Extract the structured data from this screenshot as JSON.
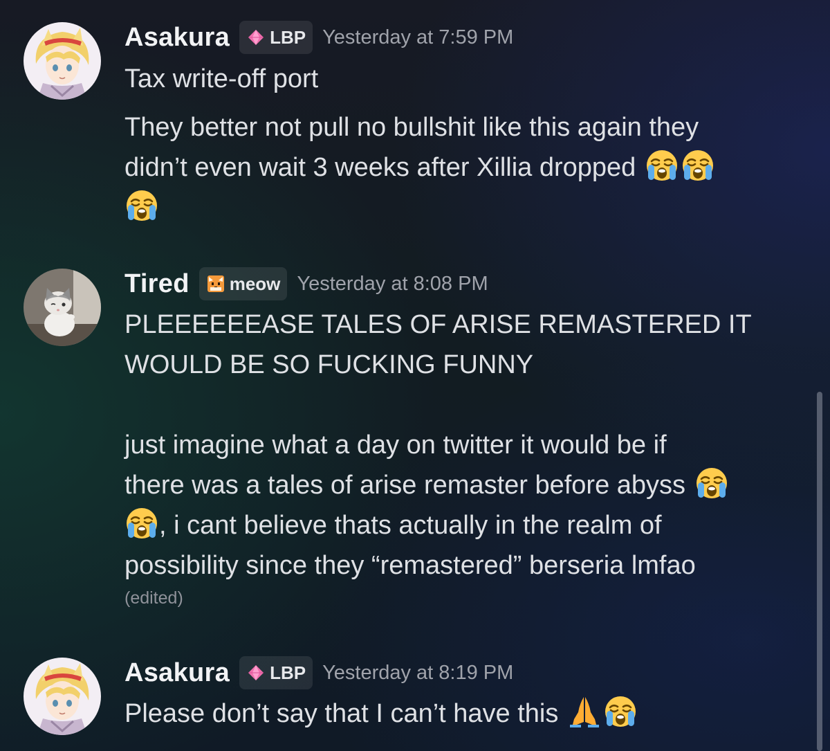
{
  "messages": [
    {
      "username": "Asakura",
      "tag": "LBP",
      "tag_icon": "pink-gem-icon",
      "timestamp": "Yesterday at 7:59 PM",
      "lines": [
        "Tax write-off port",
        "They better not pull no bullshit like this again they",
        "didn’t even wait 3 weeks after Xillia dropped"
      ]
    },
    {
      "username": "Tired",
      "tag": "meow",
      "tag_icon": "cat-face-icon",
      "timestamp": "Yesterday at 8:08 PM",
      "lines": [
        "PLEEEEEEASE TALES OF ARISE REMASTERED IT",
        "WOULD BE SO FUCKING FUNNY",
        "just imagine what a day on twitter it would be if",
        "there was a tales of arise remaster before abyss",
        ", i cant believe thats actually in the realm of",
        "possibility since they “remastered” berseria lmfao"
      ],
      "edited": "(edited)"
    },
    {
      "username": "Asakura",
      "tag": "LBP",
      "tag_icon": "pink-gem-icon",
      "timestamp": "Yesterday at 8:19 PM",
      "lines": [
        "Please don’t say that I can’t have this"
      ]
    }
  ],
  "colors": {
    "background": "#121c22",
    "username": "#f2f3f5",
    "timestamp": "#a0a3ab",
    "tag_bg": "#2b2f38",
    "scrollbar": "#8c91a0"
  }
}
